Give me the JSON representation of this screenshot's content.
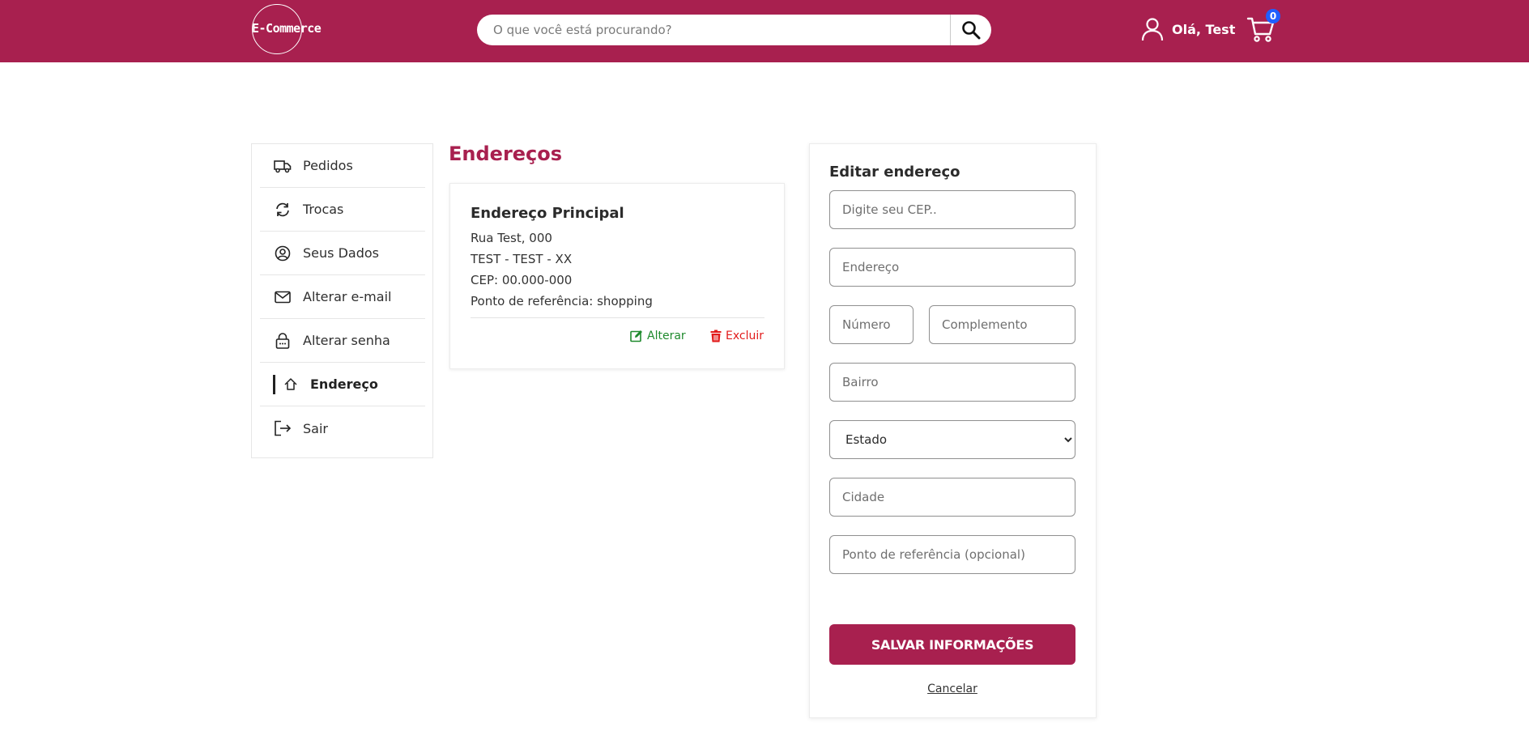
{
  "header": {
    "logo_text": "E-Commerce",
    "search_placeholder": "O que você está procurando?",
    "greeting": "Olá, Test",
    "cart_count": "0",
    "brand_color": "#a8204f",
    "badge_color": "#1f5fff",
    "icons": [
      "search-icon",
      "user-icon",
      "cart-icon"
    ]
  },
  "sidebar": {
    "items": [
      {
        "label": "Pedidos",
        "icon": "truck-icon"
      },
      {
        "label": "Trocas",
        "icon": "exchange-icon"
      },
      {
        "label": "Seus Dados",
        "icon": "user-circle-icon"
      },
      {
        "label": "Alterar e-mail",
        "icon": "envelope-icon"
      },
      {
        "label": "Alterar senha",
        "icon": "lock-icon"
      },
      {
        "label": "Endereço",
        "icon": "home-icon",
        "active": true
      },
      {
        "label": "Sair",
        "icon": "logout-icon"
      }
    ]
  },
  "main": {
    "title": "Endereços",
    "address": {
      "title": "Endereço Principal",
      "line1": "Rua Test, 000",
      "line2": "TEST - TEST - XX",
      "line3": "CEP: 00.000-000",
      "line4": "Ponto de referência: shopping",
      "edit_label": "Alterar",
      "delete_label": "Excluir",
      "edit_color": "#1f8a2d",
      "delete_color": "#e21b1b"
    }
  },
  "form": {
    "title": "Editar endereço",
    "cep_placeholder": "Digite seu CEP..",
    "endereco_placeholder": "Endereço",
    "numero_placeholder": "Número",
    "complemento_placeholder": "Complemento",
    "bairro_placeholder": "Bairro",
    "estado_selected": "Estado",
    "cidade_placeholder": "Cidade",
    "referencia_placeholder": "Ponto de referência (opcional)",
    "save_label": "SALVAR INFORMAÇÕES",
    "cancel_label": "Cancelar"
  }
}
